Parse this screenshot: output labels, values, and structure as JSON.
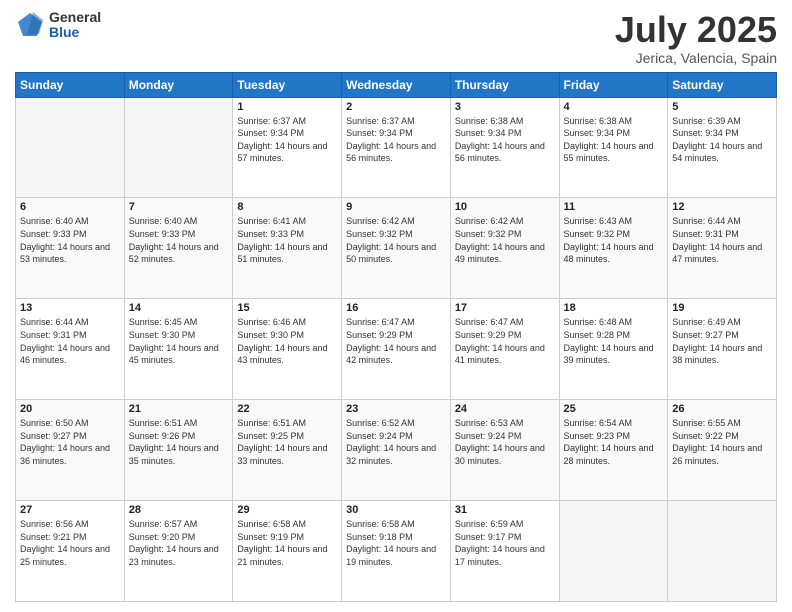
{
  "logo": {
    "general": "General",
    "blue": "Blue"
  },
  "header": {
    "month": "July 2025",
    "location": "Jerica, Valencia, Spain"
  },
  "weekdays": [
    "Sunday",
    "Monday",
    "Tuesday",
    "Wednesday",
    "Thursday",
    "Friday",
    "Saturday"
  ],
  "weeks": [
    [
      {
        "day": "",
        "sunrise": "",
        "sunset": "",
        "daylight": ""
      },
      {
        "day": "",
        "sunrise": "",
        "sunset": "",
        "daylight": ""
      },
      {
        "day": "1",
        "sunrise": "Sunrise: 6:37 AM",
        "sunset": "Sunset: 9:34 PM",
        "daylight": "Daylight: 14 hours and 57 minutes."
      },
      {
        "day": "2",
        "sunrise": "Sunrise: 6:37 AM",
        "sunset": "Sunset: 9:34 PM",
        "daylight": "Daylight: 14 hours and 56 minutes."
      },
      {
        "day": "3",
        "sunrise": "Sunrise: 6:38 AM",
        "sunset": "Sunset: 9:34 PM",
        "daylight": "Daylight: 14 hours and 56 minutes."
      },
      {
        "day": "4",
        "sunrise": "Sunrise: 6:38 AM",
        "sunset": "Sunset: 9:34 PM",
        "daylight": "Daylight: 14 hours and 55 minutes."
      },
      {
        "day": "5",
        "sunrise": "Sunrise: 6:39 AM",
        "sunset": "Sunset: 9:34 PM",
        "daylight": "Daylight: 14 hours and 54 minutes."
      }
    ],
    [
      {
        "day": "6",
        "sunrise": "Sunrise: 6:40 AM",
        "sunset": "Sunset: 9:33 PM",
        "daylight": "Daylight: 14 hours and 53 minutes."
      },
      {
        "day": "7",
        "sunrise": "Sunrise: 6:40 AM",
        "sunset": "Sunset: 9:33 PM",
        "daylight": "Daylight: 14 hours and 52 minutes."
      },
      {
        "day": "8",
        "sunrise": "Sunrise: 6:41 AM",
        "sunset": "Sunset: 9:33 PM",
        "daylight": "Daylight: 14 hours and 51 minutes."
      },
      {
        "day": "9",
        "sunrise": "Sunrise: 6:42 AM",
        "sunset": "Sunset: 9:32 PM",
        "daylight": "Daylight: 14 hours and 50 minutes."
      },
      {
        "day": "10",
        "sunrise": "Sunrise: 6:42 AM",
        "sunset": "Sunset: 9:32 PM",
        "daylight": "Daylight: 14 hours and 49 minutes."
      },
      {
        "day": "11",
        "sunrise": "Sunrise: 6:43 AM",
        "sunset": "Sunset: 9:32 PM",
        "daylight": "Daylight: 14 hours and 48 minutes."
      },
      {
        "day": "12",
        "sunrise": "Sunrise: 6:44 AM",
        "sunset": "Sunset: 9:31 PM",
        "daylight": "Daylight: 14 hours and 47 minutes."
      }
    ],
    [
      {
        "day": "13",
        "sunrise": "Sunrise: 6:44 AM",
        "sunset": "Sunset: 9:31 PM",
        "daylight": "Daylight: 14 hours and 46 minutes."
      },
      {
        "day": "14",
        "sunrise": "Sunrise: 6:45 AM",
        "sunset": "Sunset: 9:30 PM",
        "daylight": "Daylight: 14 hours and 45 minutes."
      },
      {
        "day": "15",
        "sunrise": "Sunrise: 6:46 AM",
        "sunset": "Sunset: 9:30 PM",
        "daylight": "Daylight: 14 hours and 43 minutes."
      },
      {
        "day": "16",
        "sunrise": "Sunrise: 6:47 AM",
        "sunset": "Sunset: 9:29 PM",
        "daylight": "Daylight: 14 hours and 42 minutes."
      },
      {
        "day": "17",
        "sunrise": "Sunrise: 6:47 AM",
        "sunset": "Sunset: 9:29 PM",
        "daylight": "Daylight: 14 hours and 41 minutes."
      },
      {
        "day": "18",
        "sunrise": "Sunrise: 6:48 AM",
        "sunset": "Sunset: 9:28 PM",
        "daylight": "Daylight: 14 hours and 39 minutes."
      },
      {
        "day": "19",
        "sunrise": "Sunrise: 6:49 AM",
        "sunset": "Sunset: 9:27 PM",
        "daylight": "Daylight: 14 hours and 38 minutes."
      }
    ],
    [
      {
        "day": "20",
        "sunrise": "Sunrise: 6:50 AM",
        "sunset": "Sunset: 9:27 PM",
        "daylight": "Daylight: 14 hours and 36 minutes."
      },
      {
        "day": "21",
        "sunrise": "Sunrise: 6:51 AM",
        "sunset": "Sunset: 9:26 PM",
        "daylight": "Daylight: 14 hours and 35 minutes."
      },
      {
        "day": "22",
        "sunrise": "Sunrise: 6:51 AM",
        "sunset": "Sunset: 9:25 PM",
        "daylight": "Daylight: 14 hours and 33 minutes."
      },
      {
        "day": "23",
        "sunrise": "Sunrise: 6:52 AM",
        "sunset": "Sunset: 9:24 PM",
        "daylight": "Daylight: 14 hours and 32 minutes."
      },
      {
        "day": "24",
        "sunrise": "Sunrise: 6:53 AM",
        "sunset": "Sunset: 9:24 PM",
        "daylight": "Daylight: 14 hours and 30 minutes."
      },
      {
        "day": "25",
        "sunrise": "Sunrise: 6:54 AM",
        "sunset": "Sunset: 9:23 PM",
        "daylight": "Daylight: 14 hours and 28 minutes."
      },
      {
        "day": "26",
        "sunrise": "Sunrise: 6:55 AM",
        "sunset": "Sunset: 9:22 PM",
        "daylight": "Daylight: 14 hours and 26 minutes."
      }
    ],
    [
      {
        "day": "27",
        "sunrise": "Sunrise: 6:56 AM",
        "sunset": "Sunset: 9:21 PM",
        "daylight": "Daylight: 14 hours and 25 minutes."
      },
      {
        "day": "28",
        "sunrise": "Sunrise: 6:57 AM",
        "sunset": "Sunset: 9:20 PM",
        "daylight": "Daylight: 14 hours and 23 minutes."
      },
      {
        "day": "29",
        "sunrise": "Sunrise: 6:58 AM",
        "sunset": "Sunset: 9:19 PM",
        "daylight": "Daylight: 14 hours and 21 minutes."
      },
      {
        "day": "30",
        "sunrise": "Sunrise: 6:58 AM",
        "sunset": "Sunset: 9:18 PM",
        "daylight": "Daylight: 14 hours and 19 minutes."
      },
      {
        "day": "31",
        "sunrise": "Sunrise: 6:59 AM",
        "sunset": "Sunset: 9:17 PM",
        "daylight": "Daylight: 14 hours and 17 minutes."
      },
      {
        "day": "",
        "sunrise": "",
        "sunset": "",
        "daylight": ""
      },
      {
        "day": "",
        "sunrise": "",
        "sunset": "",
        "daylight": ""
      }
    ]
  ]
}
